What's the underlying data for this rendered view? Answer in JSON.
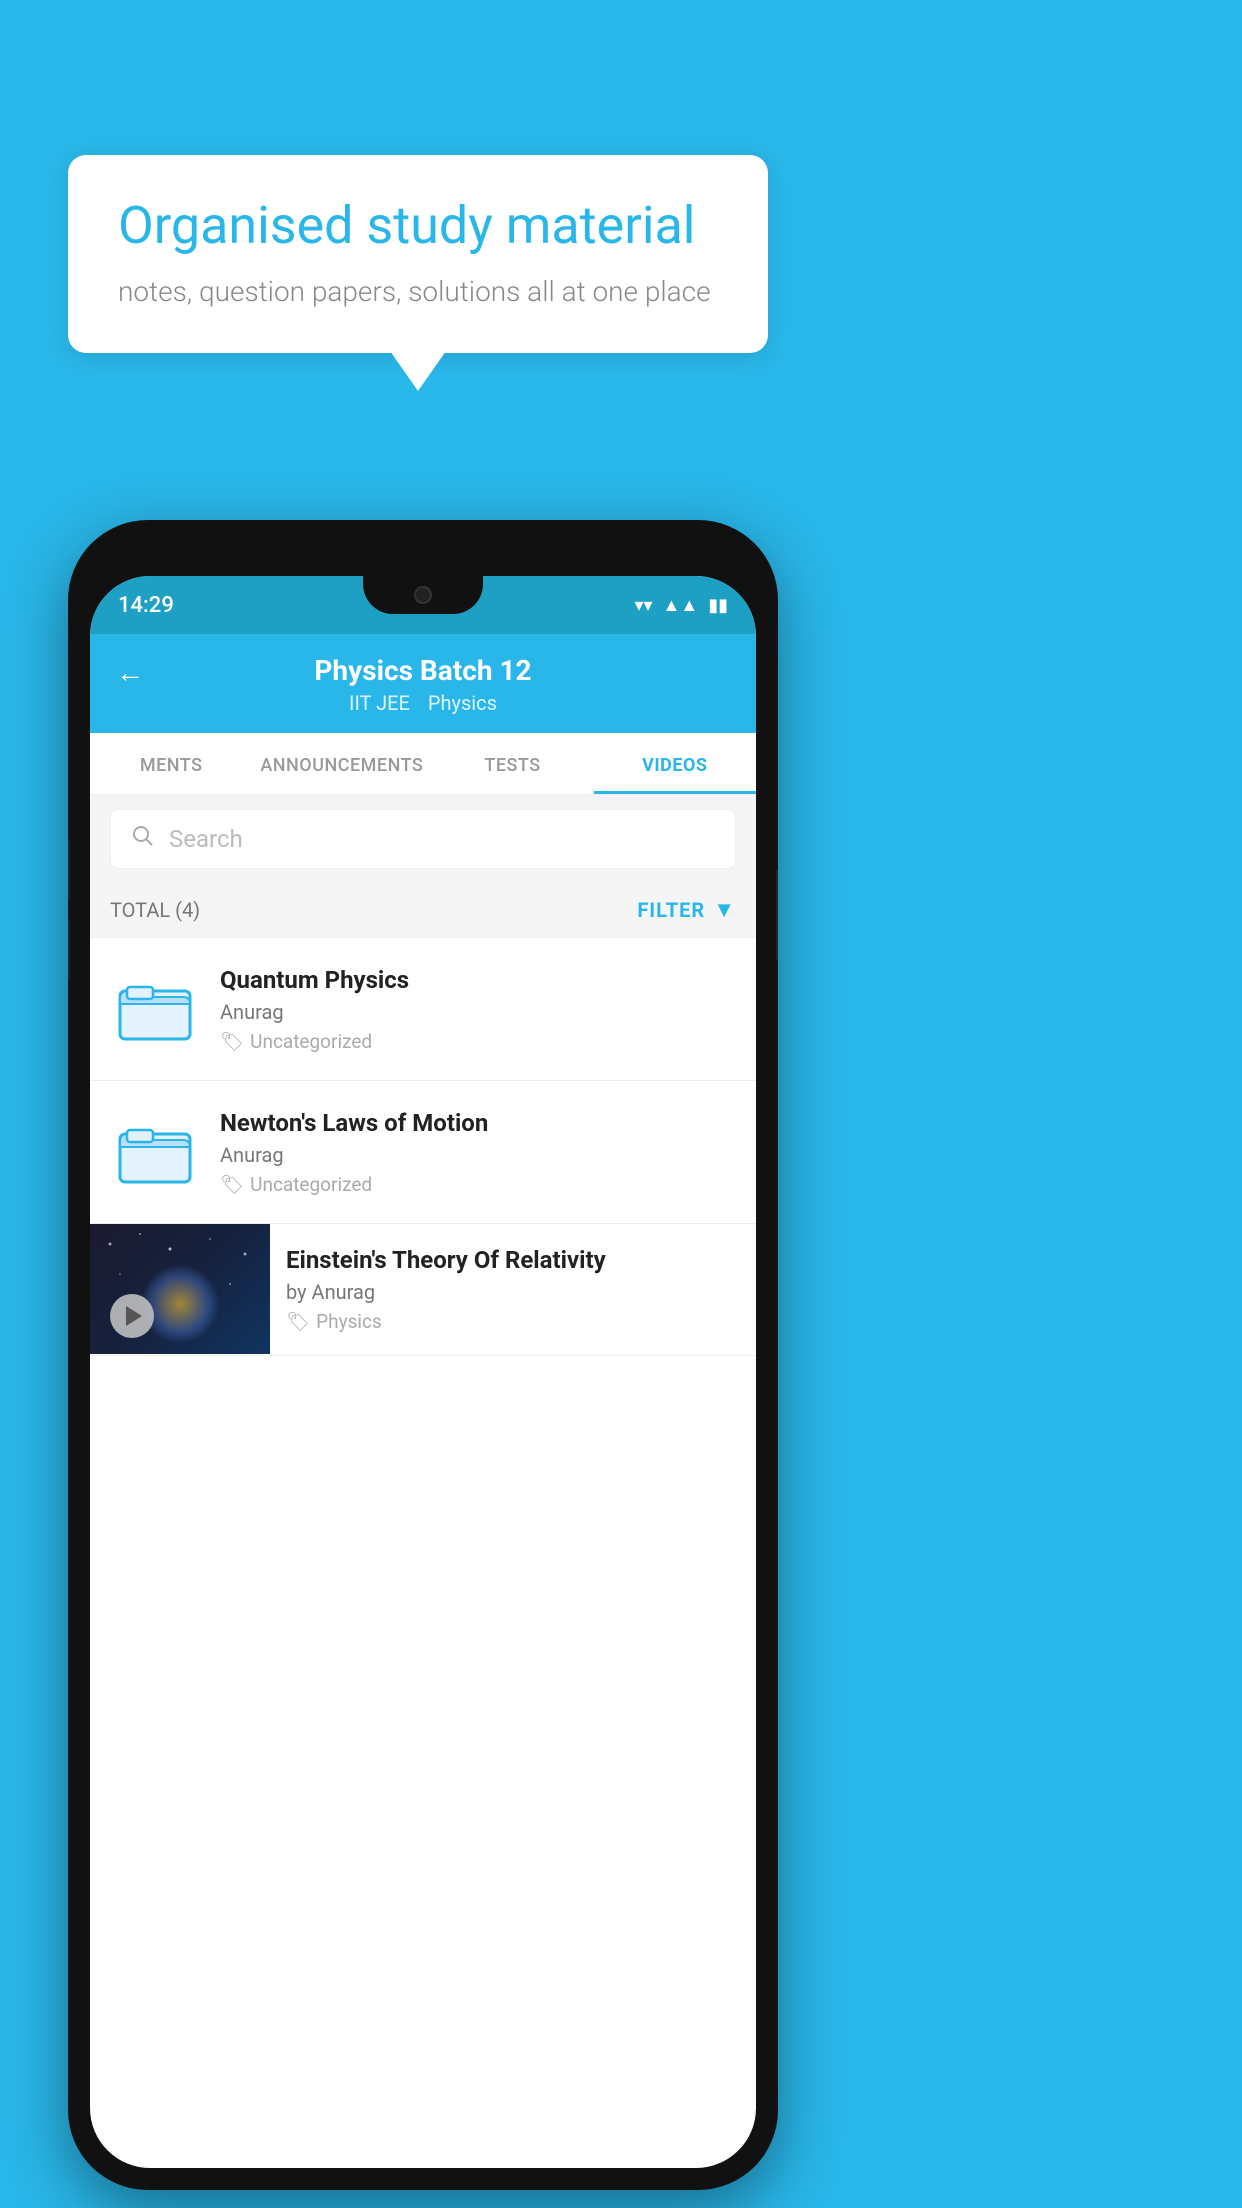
{
  "background": {
    "color": "#29b6e8"
  },
  "bubble": {
    "title": "Organised study material",
    "subtitle": "notes, question papers, solutions all at one place"
  },
  "phone": {
    "status_bar": {
      "time": "14:29",
      "icons": [
        "wifi",
        "signal",
        "battery"
      ]
    },
    "header": {
      "back_label": "←",
      "title": "Physics Batch 12",
      "subtitle_items": [
        "IIT JEE",
        "Physics"
      ]
    },
    "tabs": [
      {
        "label": "MENTS",
        "active": false
      },
      {
        "label": "ANNOUNCEMENTS",
        "active": false
      },
      {
        "label": "TESTS",
        "active": false
      },
      {
        "label": "VIDEOS",
        "active": true
      }
    ],
    "search": {
      "placeholder": "Search"
    },
    "filter_bar": {
      "total": "TOTAL (4)",
      "filter_label": "FILTER"
    },
    "videos": [
      {
        "id": 1,
        "title": "Quantum Physics",
        "author": "Anurag",
        "tag": "Uncategorized",
        "type": "folder"
      },
      {
        "id": 2,
        "title": "Newton's Laws of Motion",
        "author": "Anurag",
        "tag": "Uncategorized",
        "type": "folder"
      },
      {
        "id": 3,
        "title": "Einstein's Theory Of Relativity",
        "author": "by Anurag",
        "tag": "Physics",
        "type": "video"
      }
    ]
  }
}
